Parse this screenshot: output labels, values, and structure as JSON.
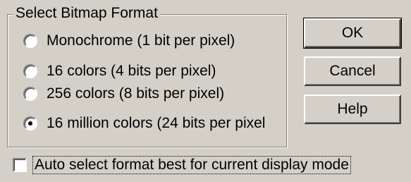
{
  "dialog": {
    "group_title": "Select Bitmap Format",
    "options": [
      {
        "label": "Monochrome (1 bit per pixel)",
        "checked": false
      },
      {
        "label": "16 colors (4 bits per pixel)",
        "checked": false
      },
      {
        "label": "256 colors (8 bits per pixel)",
        "checked": false
      },
      {
        "label": "16 million colors (24 bits per pixel",
        "checked": true
      }
    ],
    "buttons": {
      "ok": "OK",
      "cancel": "Cancel",
      "help": "Help"
    },
    "auto_select": {
      "label": "Auto select format best for current display mode",
      "checked": false
    }
  }
}
